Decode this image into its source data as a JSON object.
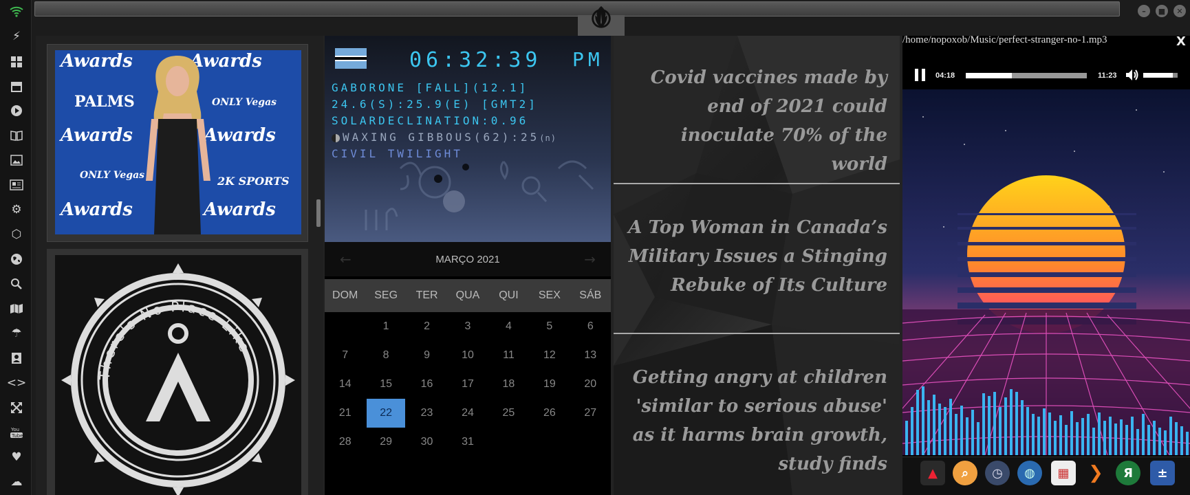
{
  "clock": {
    "time": "06:32:39",
    "ampm": "PM",
    "line1": "GABORONE [FALL](12.1]",
    "line2": "24.6(S):25.9(E) [GMT2]",
    "line3": "SOLARDECLINATION:0.96",
    "line4": "WAXING GIBBOUS(62):25",
    "line4_suffix": "(n)",
    "line5": "CIVIL TWILIGHT"
  },
  "calendar": {
    "title": "MARÇO 2021",
    "prev_icon": "chevron-left-icon",
    "next_icon": "chevron-right-icon",
    "dows": [
      "DOM",
      "SEG",
      "TER",
      "QUA",
      "QUI",
      "SEX",
      "SÁB"
    ],
    "leading_blanks": 1,
    "days": [
      "1",
      "2",
      "3",
      "4",
      "5",
      "6",
      "7",
      "8",
      "9",
      "10",
      "11",
      "12",
      "13",
      "14",
      "15",
      "16",
      "17",
      "18",
      "19",
      "20",
      "21",
      "22",
      "23",
      "24",
      "25",
      "26",
      "27",
      "28",
      "29",
      "30",
      "31"
    ],
    "today": "22"
  },
  "news": {
    "items": [
      "Covid vaccines made by end of 2021 could inoculate 70% of the world",
      "A Top Woman in Canada’s Military Issues a Stinging Rebuke of Its Culture",
      "Getting angry at children 'similar to serious abuse' as it harms brain growth, study finds"
    ]
  },
  "player": {
    "path": "/home/nopoxob/Music/perfect-stranger-no-1.mp3",
    "close": "X",
    "current_time": "04:18",
    "total_time": "11:23",
    "progress": 0.378,
    "volume": 0.85
  },
  "photo": {
    "signs": [
      "Awards",
      "Awards",
      "PALMS",
      "ONLY Vegas",
      "Awards",
      "Awards",
      "ONLY Vegas",
      "2K SPORTS",
      "Awards",
      "Awards"
    ]
  },
  "logo": {
    "ring_text": "There's No Place Like"
  },
  "dock": {
    "icons": [
      "wifi-icon",
      "bolt-icon",
      "windows-icon",
      "archive-icon",
      "play-icon",
      "book-icon",
      "image-icon",
      "news-icon",
      "settings-icon",
      "network-icon",
      "globe-icon",
      "search-icon",
      "map-icon",
      "umbrella-icon",
      "contacts-icon",
      "code-icon",
      "expand-icon",
      "youtube-icon",
      "heart-icon",
      "cloud-icon"
    ]
  },
  "launcher": {
    "icons": [
      "app-a-icon",
      "search-icon",
      "clock-icon",
      "globe-icon",
      "calendar-icon",
      "terminal-arrow-icon",
      "yandex-icon",
      "calculator-icon"
    ]
  },
  "colors": {
    "accent": "#3cc6f0",
    "today": "#4a90d9"
  }
}
